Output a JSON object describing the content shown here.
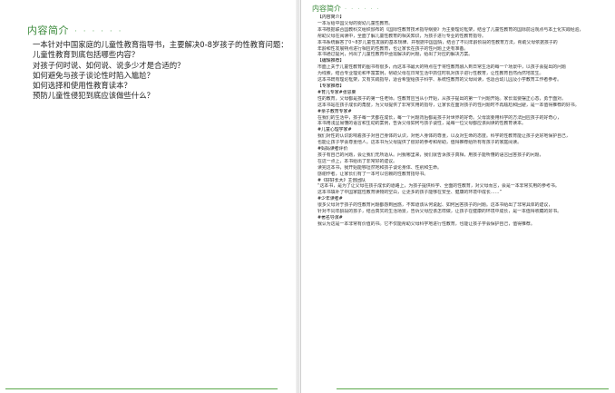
{
  "left": {
    "title": "内容简介",
    "title_dots": "· · · · · ·",
    "lines": [
      "一本针对中国家庭的儿童性教育指导书，主要解决0-8岁孩子的性教育问题：",
      "儿童性教育到底包括哪些内容？",
      "对孩子何时说、如何说、说多少才是合适的？",
      "如何避免与孩子谈论性时陷入尴尬？",
      "如何选择和使用性教育读本？",
      "预防儿童性侵犯到底应该做些什么？"
    ]
  },
  "right": {
    "title": "内容简介",
    "title_dots": "· · · · · ·",
    "lines": [
      "【内容简介】",
      "一本写给中国父母的婴幼儿童性教育。",
      "本书根据联合国教科文组织颁布的《国际性教育技术指导纲要》为主要理论框架，结合了儿童性教育的国际前沿观点与本土化实践经验，",
      "帮助父母在阅读中，全面了解儿童性教育的相关知识，为孩子进行专业的性教育指导。",
      "本书系统解答了0~8岁儿童性发展的基本规律、并根据中国国情，结合了不同年龄阶段的性教育方法，帮助父母依据孩子的",
      "年龄和性发展特点进行相应的性教育，也让家长在孩子的性问题上更有准备。",
      "本书通过提问，列出了儿童性教育中亟需解决的问题，给出了对应的解决方案。",
      "【编辑推荐】",
      "市面上关于儿童性教育的图书有很多，而这本书最大的特点在于将性教育融入到日常生活的每一个场景中，以孩子会提出的问题",
      "为线索，结合专业理论和丰富案例，帮助父母在日常生活中抓住时机对孩子进行性教育，让性教育自然而然地发生。",
      "这本书既有理论框架，又有实践指导，适合希望给孩子科学、系统性教育的父母阅读，也适合幼儿园及小学教育工作者参考。",
      "【专家推荐】",
      "#育儿专家#张思莱",
      "性的教育，父母都是孩子的第一任老师。性教育应当从小开始，从孩子提出的第一个问题开始。家长需要摆正心态，勇于面对。",
      "这本书站在孩子成长的角度，为父母提供了非常实用的指导，让家长在面对孩子的性问题时不再尴尬和回避，是一本值得推荐的好书。",
      "#亲子教育专家#",
      "在我们的生活中，孩子每一天都在成长，每一个问题背后都是孩子对世界的好奇。父母需要用科学的方法回应孩子的好奇心，",
      "本书用浅显易懂的语言和生动的案例，告诉父母如何与孩子谈性，是每一位父母都应该阅读的性教育读本。",
      "#儿童心理学家#",
      "我们对性的认识影响着孩子对自己身体的认识，对他人身体的尊重，以及对生命的态度。科学的性教育能让孩子更好地保护自己，",
      "也能让孩子学会尊重他人。这本书为父母提供了很好的参考和帮助，值得推荐给所有有孩子的家庭阅读。",
      "#妈妈读者评价",
      "孩子有自己的问题，会让我们无所适从。问我哪里来，我们就告诉孩子真相，用孩子能听懂的语言回答孩子的问题，",
      "在这一点上，本书给出了非常好的建议。",
      "读完这本书，我开始能够坦然地和孩子谈论身体、性别和生命。",
      "感谢作者，让家长们有了一本可以信赖的性教育指导书。",
      "#《好好长大》主创团队",
      "“这本书，是为了让父母在孩子成长的道路上，为孩子提供科学、全面的性教育，对父母而言，会是一本非常实用的参考书。",
      "这本书填补了中国家庭性教育读物的空白，让更多的孩子能够在安全、健康的环境中成长……”",
      "#少年读者#",
      "很多父母对于孩子的性教育问题都感到困惑，不知道该从何说起、如何回答孩子的问题。这本书给出了非常具体的建议，",
      "针对不同年龄段的孩子，结合真实的生活场景，告诉父母应该怎样做，让孩子在健康的环境中成长，是一本值得收藏的好书。",
      "#著名导演#",
      "我认为这是一本非常有价值的书。它不仅能帮助父母科学地进行性教育，也能让孩子学会保护自己，值得推荐。"
    ]
  }
}
